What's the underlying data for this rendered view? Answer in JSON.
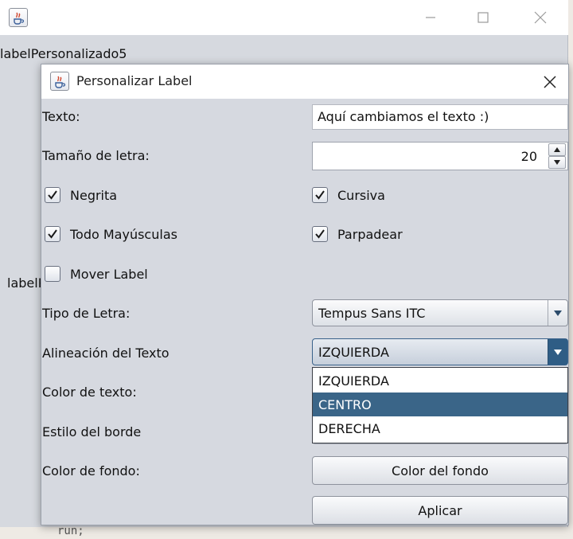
{
  "main_window": {
    "title": "",
    "labels": [
      "labelPersonalizado5",
      "labelP"
    ]
  },
  "ide": {
    "code_fragment": "run;"
  },
  "dialog": {
    "title": "Personalizar Label",
    "texto_label": "Texto:",
    "texto_value": "Aquí cambiamos el texto :)",
    "tamano_label": "Tamaño de letra:",
    "tamano_value": "20",
    "checkboxes": {
      "negrita": {
        "label": "Negrita",
        "checked": true
      },
      "cursiva": {
        "label": "Cursiva",
        "checked": true
      },
      "mayusculas": {
        "label": "Todo Mayúsculas",
        "checked": true
      },
      "parpadear": {
        "label": "Parpadear",
        "checked": true
      },
      "mover": {
        "label": "Mover Label",
        "checked": false
      }
    },
    "tipo_letra_label": "Tipo de Letra:",
    "tipo_letra_value": "Tempus Sans ITC",
    "alineacion_label": "Alineación del Texto",
    "alineacion_value": "IZQUIERDA",
    "alineacion_options": [
      "IZQUIERDA",
      "CENTRO",
      "DERECHA"
    ],
    "alineacion_highlighted": "CENTRO",
    "color_texto_label": "Color de texto:",
    "estilo_borde_label": "Estilo del borde",
    "color_fondo_label": "Color de fondo:",
    "color_fondo_button": "Color del fondo",
    "aplicar_button": "Aplicar"
  },
  "colors": {
    "window_bg": "#d6d9df",
    "selection": "#3a6588",
    "focus_arrow": "#2f5d85"
  }
}
